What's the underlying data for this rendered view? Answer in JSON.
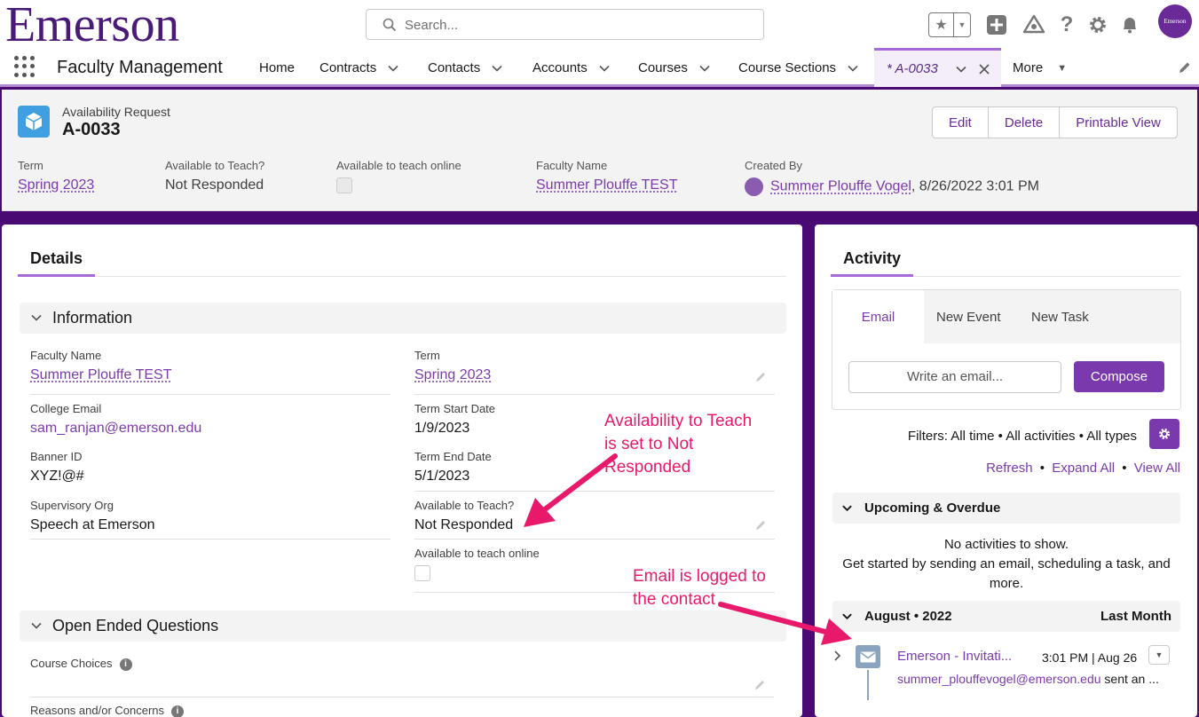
{
  "brand": {
    "logo_text": "Emerson",
    "avatar_text": "Emerson"
  },
  "search": {
    "placeholder": "Search..."
  },
  "nav": {
    "app_name": "Faculty Management",
    "items": [
      {
        "label": "Home"
      },
      {
        "label": "Contracts"
      },
      {
        "label": "Contacts"
      },
      {
        "label": "Accounts"
      },
      {
        "label": "Courses"
      },
      {
        "label": "Course Sections"
      }
    ],
    "active_tab": "* A-0033",
    "more": "More"
  },
  "record": {
    "type": "Availability Request",
    "name": "A-0033",
    "buttons": {
      "edit": "Edit",
      "delete": "Delete",
      "print": "Printable View"
    },
    "highlights": {
      "term_label": "Term",
      "term_value": "Spring 2023",
      "avail_label": "Available to Teach?",
      "avail_value": "Not Responded",
      "online_label": "Available to teach online",
      "faculty_label": "Faculty Name",
      "faculty_value": "Summer Plouffe TEST",
      "created_label": "Created By",
      "created_by": "Summer Plouffe Vogel",
      "created_date": ", 8/26/2022 3:01 PM"
    }
  },
  "details": {
    "tab": "Details",
    "section_info": "Information",
    "fields": {
      "faculty_name_label": "Faculty Name",
      "faculty_name_value": "Summer Plouffe TEST",
      "college_email_label": "College Email",
      "college_email_value": "sam_ranjan@emerson.edu",
      "banner_label": "Banner ID",
      "banner_value": "XYZ!@#",
      "sup_org_label": "Supervisory Org",
      "sup_org_value": "Speech at Emerson",
      "term_label": "Term",
      "term_value": "Spring 2023",
      "term_start_label": "Term Start Date",
      "term_start_value": "1/9/2023",
      "term_end_label": "Term End Date",
      "term_end_value": "5/1/2023",
      "avail_label": "Available to Teach?",
      "avail_value": "Not Responded",
      "online_label": "Available to teach online"
    },
    "section_questions": "Open Ended Questions",
    "course_choices_label": "Course Choices",
    "reasons_label": "Reasons and/or Concerns"
  },
  "activity": {
    "tab": "Activity",
    "tabs": {
      "email": "Email",
      "event": "New Event",
      "task": "New Task"
    },
    "email_placeholder": "Write an email...",
    "compose": "Compose",
    "filters": "Filters: All time • All activities • All types",
    "refresh": "Refresh",
    "expand": "Expand All",
    "view_all": "View All",
    "sep": "•",
    "upcoming": "Upcoming & Overdue",
    "no_activities": "No activities to show.",
    "get_started": "Get started by sending an email, scheduling a task, and more.",
    "month": "August • 2022",
    "month_right": "Last Month",
    "item_title": "Emerson - Invitati...",
    "item_time": "3:01 PM | Aug 26",
    "item_from": "summer_plouffevogel@emerson.edu",
    "item_rest": " sent an ..."
  },
  "annotations": {
    "a1_l1": "Availability to Teach",
    "a1_l2": "is set to Not",
    "a1_l3": "Responded",
    "a2_l1": "Email is logged to",
    "a2_l2": "the contact"
  },
  "colors": {
    "brand_purple": "#7a3aae",
    "annotation": "#e8196b",
    "page_bg": "#4a0a73"
  }
}
